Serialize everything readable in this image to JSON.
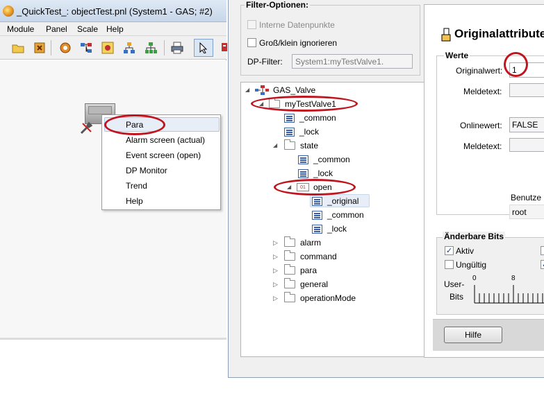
{
  "window1": {
    "title": "_QuickTest_: objectTest.pnl (System1 - GAS; #2)",
    "menu": [
      "Module",
      "Panel",
      "Scale",
      "Help"
    ],
    "toolbar_icons": [
      "open-folder-icon",
      "close-icon",
      "settings-gear-icon",
      "tree-icon",
      "image-icon",
      "hierarchy-icon",
      "network-icon",
      "print-icon",
      "select-arrow-icon",
      "screen-icon"
    ]
  },
  "context_menu": {
    "items": [
      "Para",
      "Alarm screen (actual)",
      "Event screen (open)",
      "DP Monitor",
      "Trend",
      "Help"
    ]
  },
  "window2": {
    "filter": {
      "title": "Filter-Optionen:",
      "internal_dp_label": "Interne Datenpunkte",
      "ignore_case_label": "Groß/klein ignorieren",
      "dp_filter_label": "DP-Filter:",
      "dp_filter_value": "System1:myTestValve1."
    },
    "tree": {
      "root": "GAS_Valve",
      "dp": "myTestValve1",
      "nodes": {
        "common1": "_common",
        "lock1": "_lock",
        "state": "state",
        "common2": "_common",
        "lock2": "_lock",
        "open": "open",
        "open_original": "_original",
        "open_common": "_common",
        "open_lock": "_lock",
        "alarm": "alarm",
        "command": "command",
        "para": "para",
        "general": "general",
        "operationMode": "operationMode"
      }
    },
    "attributes": {
      "header": "Originalattribute",
      "werte_label": "Werte",
      "originalwert_label": "Originalwert:",
      "originalwert_value": "1",
      "meldetext1_label": "Meldetext:",
      "onlinewert_label": "Onlinewert:",
      "onlinewert_value": "FALSE",
      "meldetext2_label": "Meldetext:",
      "benutzer_label": "Benutze",
      "benutzer_value": "root"
    },
    "bits": {
      "title": "Änderbare Bits",
      "aktiv_label": "Aktiv",
      "aktiv_checked": true,
      "ungueltig_label": "Ungültig",
      "ungueltig_checked": false,
      "user_bits_label1": "User-",
      "user_bits_label2": "Bits",
      "scale_0": "0",
      "scale_8": "8"
    },
    "help_button": "Hilfe"
  },
  "colors": {
    "annotation": "#c0141e",
    "selection": "#e8eef7"
  }
}
